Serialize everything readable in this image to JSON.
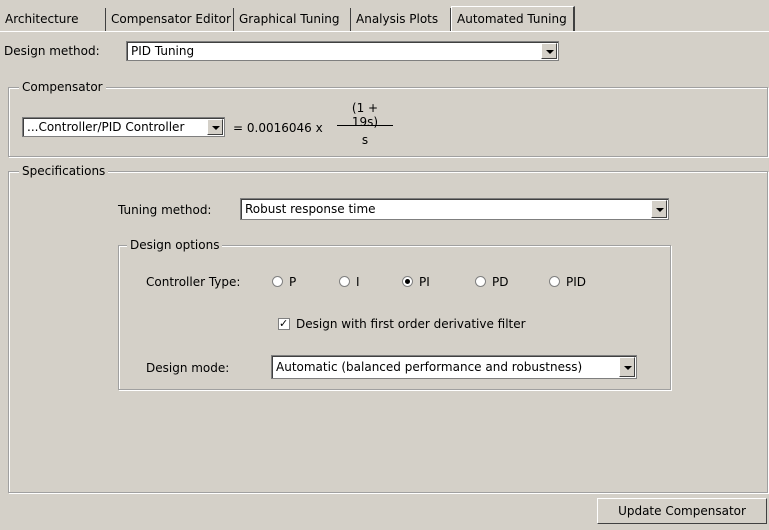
{
  "tabs": [
    "Architecture",
    "Compensator Editor",
    "Graphical Tuning",
    "Analysis Plots",
    "Automated Tuning"
  ],
  "active_tab": "Automated Tuning",
  "design_method": {
    "label": "Design method:",
    "value": "PID Tuning"
  },
  "compensator": {
    "title": "Compensator",
    "block": "...Controller/PID Controller",
    "equals": "= 0.0016046 x",
    "numerator": "(1 + 19s)",
    "denominator": "s"
  },
  "specifications": {
    "title": "Specifications",
    "tuning_method_label": "Tuning method:",
    "tuning_method_value": "Robust response time",
    "design_options": {
      "title": "Design options",
      "controller_type_label": "Controller Type:",
      "controller_types": [
        "P",
        "I",
        "PI",
        "PD",
        "PID"
      ],
      "selected_type": "PI",
      "derivative_filter_label": "Design with first order derivative filter",
      "derivative_filter_checked": true,
      "design_mode_label": "Design mode:",
      "design_mode_value": "Automatic (balanced performance and robustness)"
    }
  },
  "update_button": "Update Compensator"
}
